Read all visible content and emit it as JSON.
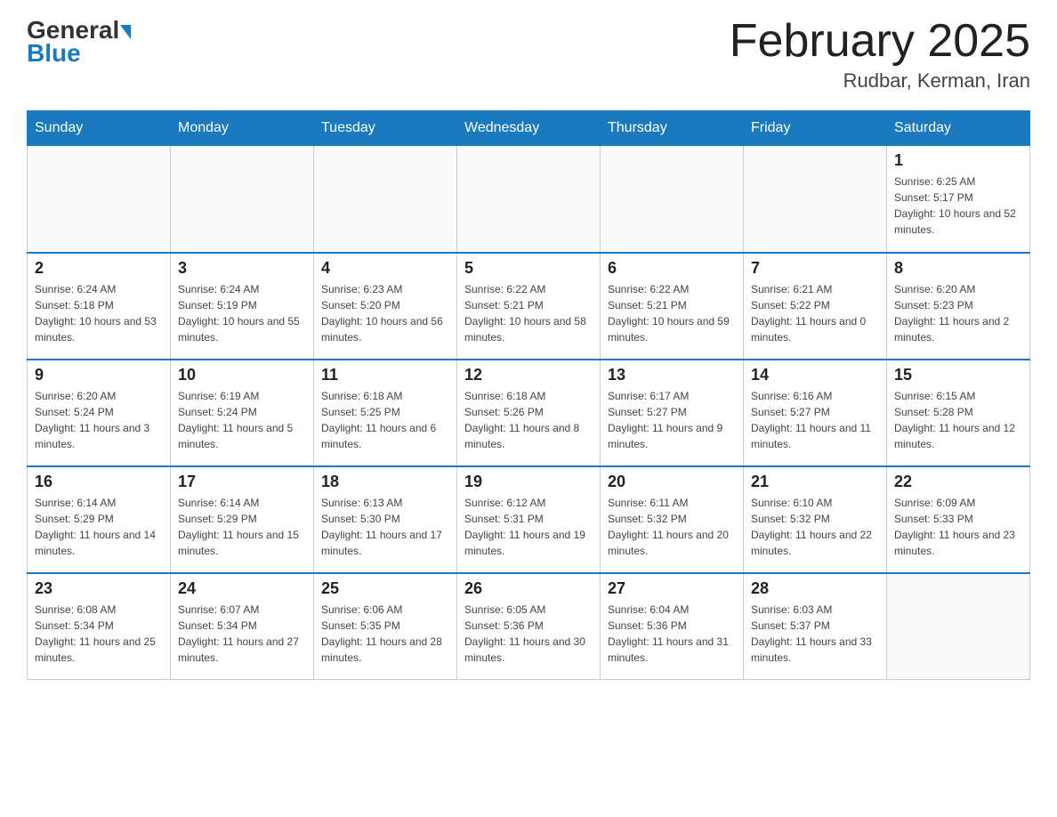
{
  "header": {
    "logo_general": "General",
    "logo_blue": "Blue",
    "month_title": "February 2025",
    "location": "Rudbar, Kerman, Iran"
  },
  "days_of_week": [
    "Sunday",
    "Monday",
    "Tuesday",
    "Wednesday",
    "Thursday",
    "Friday",
    "Saturday"
  ],
  "weeks": [
    {
      "days": [
        {
          "num": "",
          "info": ""
        },
        {
          "num": "",
          "info": ""
        },
        {
          "num": "",
          "info": ""
        },
        {
          "num": "",
          "info": ""
        },
        {
          "num": "",
          "info": ""
        },
        {
          "num": "",
          "info": ""
        },
        {
          "num": "1",
          "info": "Sunrise: 6:25 AM\nSunset: 5:17 PM\nDaylight: 10 hours and 52 minutes."
        }
      ]
    },
    {
      "days": [
        {
          "num": "2",
          "info": "Sunrise: 6:24 AM\nSunset: 5:18 PM\nDaylight: 10 hours and 53 minutes."
        },
        {
          "num": "3",
          "info": "Sunrise: 6:24 AM\nSunset: 5:19 PM\nDaylight: 10 hours and 55 minutes."
        },
        {
          "num": "4",
          "info": "Sunrise: 6:23 AM\nSunset: 5:20 PM\nDaylight: 10 hours and 56 minutes."
        },
        {
          "num": "5",
          "info": "Sunrise: 6:22 AM\nSunset: 5:21 PM\nDaylight: 10 hours and 58 minutes."
        },
        {
          "num": "6",
          "info": "Sunrise: 6:22 AM\nSunset: 5:21 PM\nDaylight: 10 hours and 59 minutes."
        },
        {
          "num": "7",
          "info": "Sunrise: 6:21 AM\nSunset: 5:22 PM\nDaylight: 11 hours and 0 minutes."
        },
        {
          "num": "8",
          "info": "Sunrise: 6:20 AM\nSunset: 5:23 PM\nDaylight: 11 hours and 2 minutes."
        }
      ]
    },
    {
      "days": [
        {
          "num": "9",
          "info": "Sunrise: 6:20 AM\nSunset: 5:24 PM\nDaylight: 11 hours and 3 minutes."
        },
        {
          "num": "10",
          "info": "Sunrise: 6:19 AM\nSunset: 5:24 PM\nDaylight: 11 hours and 5 minutes."
        },
        {
          "num": "11",
          "info": "Sunrise: 6:18 AM\nSunset: 5:25 PM\nDaylight: 11 hours and 6 minutes."
        },
        {
          "num": "12",
          "info": "Sunrise: 6:18 AM\nSunset: 5:26 PM\nDaylight: 11 hours and 8 minutes."
        },
        {
          "num": "13",
          "info": "Sunrise: 6:17 AM\nSunset: 5:27 PM\nDaylight: 11 hours and 9 minutes."
        },
        {
          "num": "14",
          "info": "Sunrise: 6:16 AM\nSunset: 5:27 PM\nDaylight: 11 hours and 11 minutes."
        },
        {
          "num": "15",
          "info": "Sunrise: 6:15 AM\nSunset: 5:28 PM\nDaylight: 11 hours and 12 minutes."
        }
      ]
    },
    {
      "days": [
        {
          "num": "16",
          "info": "Sunrise: 6:14 AM\nSunset: 5:29 PM\nDaylight: 11 hours and 14 minutes."
        },
        {
          "num": "17",
          "info": "Sunrise: 6:14 AM\nSunset: 5:29 PM\nDaylight: 11 hours and 15 minutes."
        },
        {
          "num": "18",
          "info": "Sunrise: 6:13 AM\nSunset: 5:30 PM\nDaylight: 11 hours and 17 minutes."
        },
        {
          "num": "19",
          "info": "Sunrise: 6:12 AM\nSunset: 5:31 PM\nDaylight: 11 hours and 19 minutes."
        },
        {
          "num": "20",
          "info": "Sunrise: 6:11 AM\nSunset: 5:32 PM\nDaylight: 11 hours and 20 minutes."
        },
        {
          "num": "21",
          "info": "Sunrise: 6:10 AM\nSunset: 5:32 PM\nDaylight: 11 hours and 22 minutes."
        },
        {
          "num": "22",
          "info": "Sunrise: 6:09 AM\nSunset: 5:33 PM\nDaylight: 11 hours and 23 minutes."
        }
      ]
    },
    {
      "days": [
        {
          "num": "23",
          "info": "Sunrise: 6:08 AM\nSunset: 5:34 PM\nDaylight: 11 hours and 25 minutes."
        },
        {
          "num": "24",
          "info": "Sunrise: 6:07 AM\nSunset: 5:34 PM\nDaylight: 11 hours and 27 minutes."
        },
        {
          "num": "25",
          "info": "Sunrise: 6:06 AM\nSunset: 5:35 PM\nDaylight: 11 hours and 28 minutes."
        },
        {
          "num": "26",
          "info": "Sunrise: 6:05 AM\nSunset: 5:36 PM\nDaylight: 11 hours and 30 minutes."
        },
        {
          "num": "27",
          "info": "Sunrise: 6:04 AM\nSunset: 5:36 PM\nDaylight: 11 hours and 31 minutes."
        },
        {
          "num": "28",
          "info": "Sunrise: 6:03 AM\nSunset: 5:37 PM\nDaylight: 11 hours and 33 minutes."
        },
        {
          "num": "",
          "info": ""
        }
      ]
    }
  ]
}
